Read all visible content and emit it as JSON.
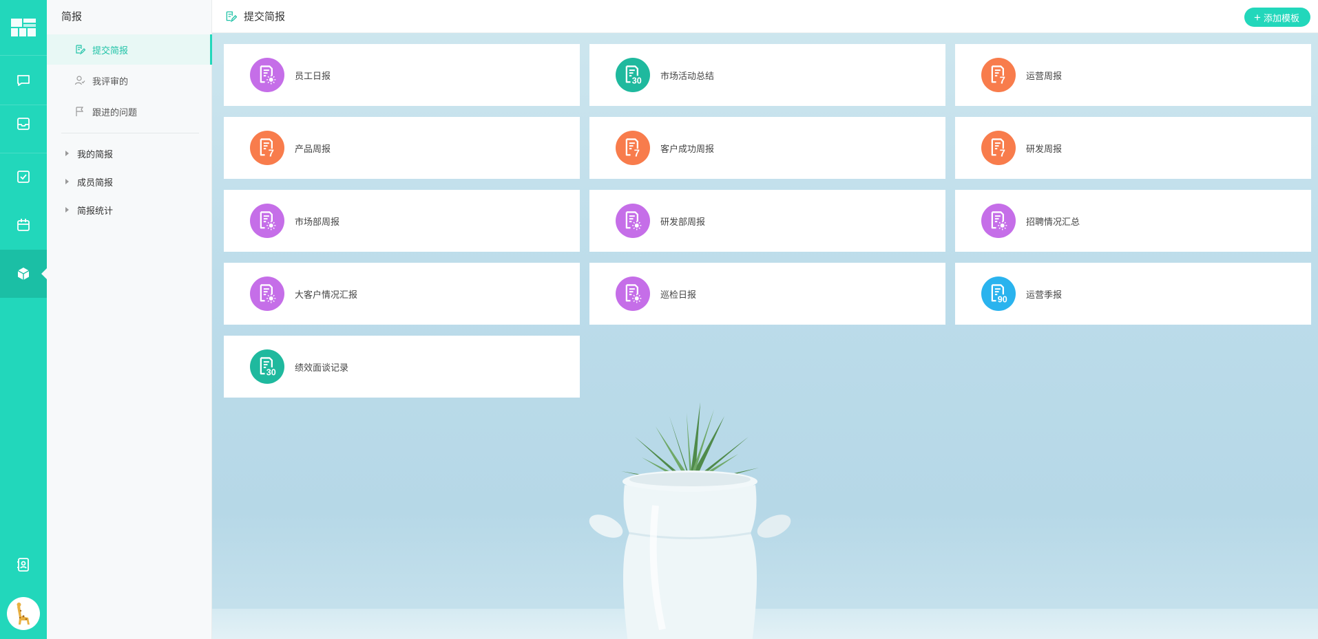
{
  "app": {
    "rail": {
      "items": [
        {
          "name": "chat",
          "icon": "chat-bubble-icon"
        },
        {
          "name": "inbox",
          "icon": "inbox-icon"
        },
        {
          "name": "tasks",
          "icon": "check-square-icon"
        },
        {
          "name": "calendar",
          "icon": "calendar-icon"
        },
        {
          "name": "reports",
          "icon": "cube-icon",
          "active": true
        },
        {
          "name": "contacts",
          "icon": "contacts-icon"
        }
      ],
      "avatar_icon": "giraffe-avatar-icon"
    }
  },
  "sidebar": {
    "title": "简报",
    "items": [
      {
        "label": "提交简报",
        "icon": "edit-doc-icon",
        "active": true
      },
      {
        "label": "我评审的",
        "icon": "user-review-icon"
      },
      {
        "label": "跟进的问题",
        "icon": "flag-icon"
      }
    ],
    "groups": [
      {
        "label": "我的简报"
      },
      {
        "label": "成员简报"
      },
      {
        "label": "简报统计"
      }
    ]
  },
  "header": {
    "title": "提交简报",
    "add_button": "添加模板"
  },
  "colors": {
    "accent": "#22d7bb",
    "purple": "#c56ee8",
    "teal": "#1fb99e",
    "orange": "#f87c4c",
    "blue": "#2ab3ee"
  },
  "templates": [
    {
      "label": "员工日报",
      "badge": "sun",
      "color": "purple"
    },
    {
      "label": "市场活动总结",
      "badge": "30",
      "color": "teal"
    },
    {
      "label": "运营周报",
      "badge": "7",
      "color": "orange"
    },
    {
      "label": "产品周报",
      "badge": "7",
      "color": "orange"
    },
    {
      "label": "客户成功周报",
      "badge": "7",
      "color": "orange"
    },
    {
      "label": "研发周报",
      "badge": "7",
      "color": "orange"
    },
    {
      "label": "市场部周报",
      "badge": "sun",
      "color": "purple"
    },
    {
      "label": "研发部周报",
      "badge": "sun",
      "color": "purple"
    },
    {
      "label": "招聘情况汇总",
      "badge": "sun",
      "color": "purple"
    },
    {
      "label": "大客户情况汇报",
      "badge": "sun",
      "color": "purple"
    },
    {
      "label": "巡检日报",
      "badge": "sun",
      "color": "purple"
    },
    {
      "label": "运营季报",
      "badge": "90",
      "color": "blue"
    },
    {
      "label": "绩效面谈记录",
      "badge": "30",
      "color": "teal"
    }
  ]
}
